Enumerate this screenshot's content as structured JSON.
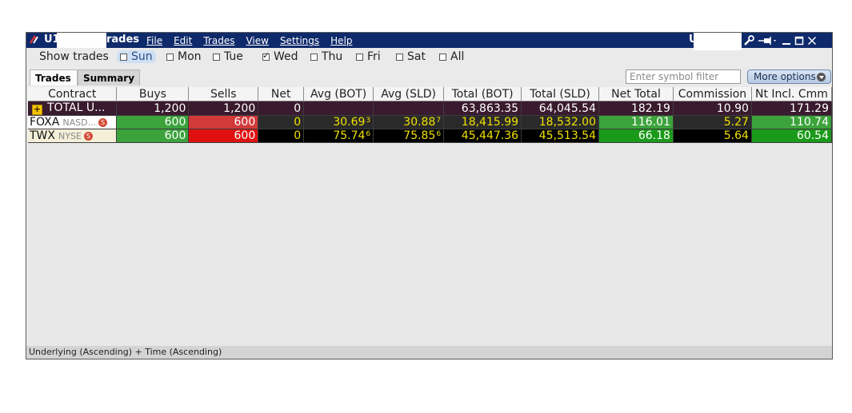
{
  "window": {
    "account_prefix": "U1",
    "title": "rades",
    "account_right": "U",
    "menu": [
      "File",
      "Edit",
      "Trades",
      "View",
      "Settings",
      "Help"
    ]
  },
  "show_trades": {
    "label": "Show trades",
    "days": [
      {
        "label": "Sun",
        "checked": false,
        "highlighted": true
      },
      {
        "label": "Mon",
        "checked": false
      },
      {
        "label": "Tue",
        "checked": false
      },
      {
        "label": "Wed",
        "checked": true
      },
      {
        "label": "Thu",
        "checked": false
      },
      {
        "label": "Fri",
        "checked": false
      },
      {
        "label": "Sat",
        "checked": false
      },
      {
        "label": "All",
        "checked": false
      }
    ]
  },
  "tabs": [
    "Trades",
    "Summary"
  ],
  "filter": {
    "placeholder": "Enter symbol filter"
  },
  "more_options": "More options",
  "table": {
    "columns": [
      "Contract",
      "Buys",
      "Sells",
      "Net",
      "Avg (BOT)",
      "Avg (SLD)",
      "Total (BOT)",
      "Total (SLD)",
      "Net Total",
      "Commission",
      "Nt Incl. Cmm"
    ],
    "rows": [
      {
        "contract": "TOTAL   U...",
        "exchange": "",
        "expandable": true,
        "buys": "1,200",
        "sells": "1,200",
        "net": "0",
        "avg_bot": "",
        "avg_bot_sup": "",
        "avg_sld": "",
        "avg_sld_sup": "",
        "total_bot": "63,863.35",
        "total_sld": "64,045.54",
        "net_total": "182.19",
        "commission": "10.90",
        "nt_incl_cmm": "171.29"
      },
      {
        "contract": "FOXA",
        "exchange": "NASD...",
        "expandable": false,
        "buys": "600",
        "sells": "600",
        "net": "0",
        "avg_bot": "30.69",
        "avg_bot_sup": "3",
        "avg_sld": "30.88",
        "avg_sld_sup": "7",
        "total_bot": "18,415.99",
        "total_sld": "18,532.00",
        "net_total": "116.01",
        "commission": "5.27",
        "nt_incl_cmm": "110.74"
      },
      {
        "contract": "TWX",
        "exchange": "NYSE",
        "expandable": false,
        "buys": "600",
        "sells": "600",
        "net": "0",
        "avg_bot": "75.74",
        "avg_bot_sup": "6",
        "avg_sld": "75.85",
        "avg_sld_sup": "6",
        "total_bot": "45,447.36",
        "total_sld": "45,513.54",
        "net_total": "66.18",
        "commission": "5.64",
        "nt_incl_cmm": "60.54"
      }
    ]
  },
  "status": "Underlying (Ascending)  +  Time (Ascending)",
  "colors": {
    "title_bar": "#0f2a6b",
    "total_row": "#3a1a2e",
    "buy_green": "#3ca33c",
    "sell_red_light": "#d23a3a",
    "sell_red": "#e01010",
    "cell_dark": "#2a2a2a",
    "cell_black": "#000000",
    "text_yellow": "#f0e000",
    "net_green": "#1a9a1a"
  }
}
